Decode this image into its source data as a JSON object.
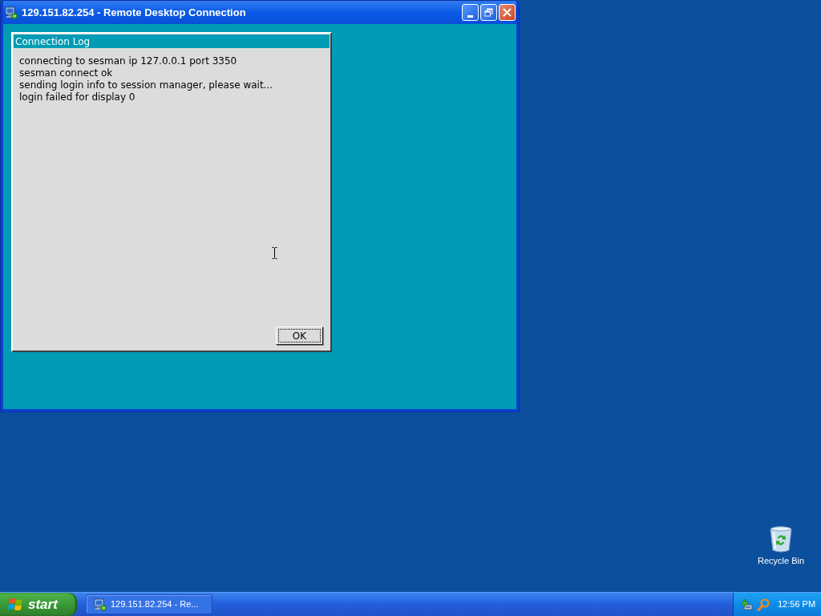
{
  "window": {
    "title": "129.151.82.254 - Remote Desktop Connection"
  },
  "dialog": {
    "title": "Connection Log",
    "lines": [
      "connecting to sesman ip 127.0.0.1 port 3350",
      "sesman connect ok",
      "sending login info to session manager, please wait...",
      "login failed for display 0"
    ],
    "button": "OK"
  },
  "desktop_icons": [
    {
      "label": "Recycle Bin"
    }
  ],
  "taskbar": {
    "start": "start",
    "tasks": [
      {
        "label": "129.151.82.254 - Re...",
        "selected": false
      }
    ],
    "clock": "12:56 PM"
  }
}
